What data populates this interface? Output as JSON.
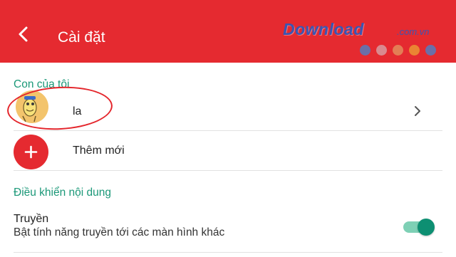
{
  "header": {
    "back_icon": "back-chevron-icon",
    "title": "Cài đặt",
    "background": "#e52a30"
  },
  "watermark": {
    "brand": "Download",
    "domain": ".com.vn",
    "dot_colors": [
      "#6b6fa8",
      "#d98a8f",
      "#e37d55",
      "#ea8433",
      "#6b6fa8"
    ]
  },
  "children_section": {
    "label": "Con của tôi",
    "items": [
      {
        "name": "la",
        "avatar_icon": "cartoon-avatar-icon",
        "chevron_icon": "chevron-right-icon"
      }
    ],
    "add": {
      "label": "Thêm mới",
      "icon": "plus-icon"
    }
  },
  "content_section": {
    "label": "Điều khiển nội dung",
    "cast": {
      "title": "Truyền",
      "description": "Bật tính năng truyền tới các màn hình khác",
      "enabled": true
    }
  },
  "colors": {
    "accent": "#e52a30",
    "section_label": "#1b9878",
    "toggle_on": "#0d8f72"
  }
}
